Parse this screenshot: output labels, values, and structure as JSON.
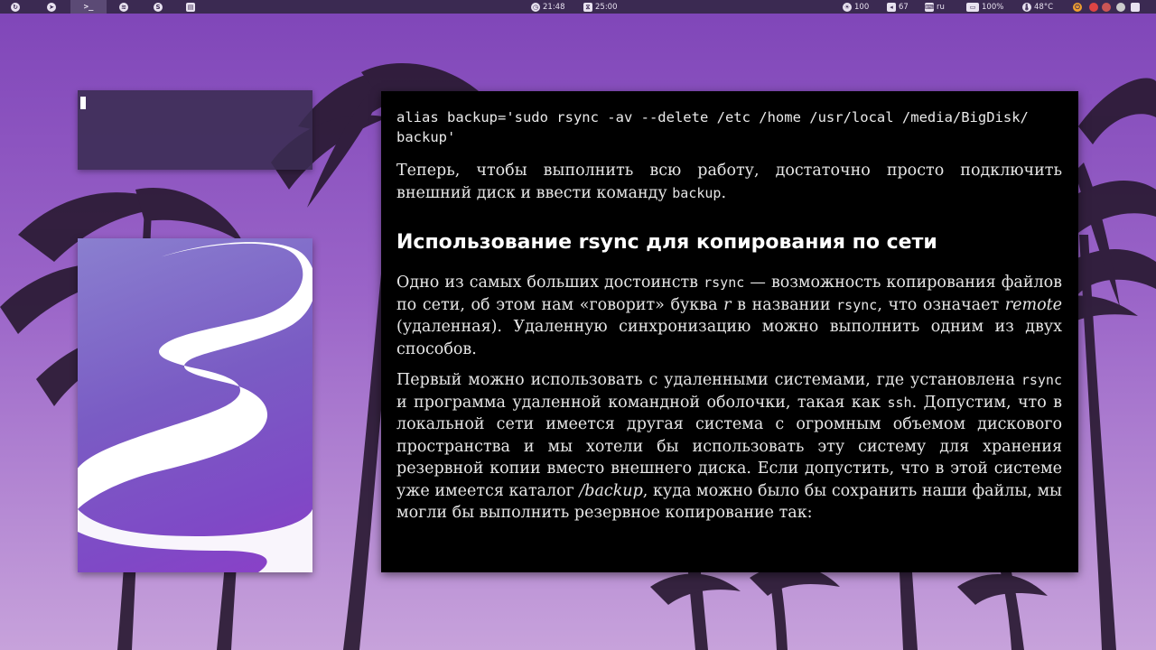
{
  "topbar": {
    "clock": "21:48",
    "timer": "25:00",
    "brightness": "100",
    "volume": "67",
    "keyboard_layout": "ru",
    "battery": "100%",
    "temperature": "48°C"
  },
  "document": {
    "code_line": "alias backup='sudo rsync -av --delete /etc /home /usr/local /media/BigDisk/\nbackup'",
    "p1": {
      "before": "Теперь, чтобы выполнить всю работу, достаточно просто подключить внешний диск и ввести команду ",
      "cmd": "backup",
      "after": "."
    },
    "heading": "Использование rsync для копирования по сети",
    "p2": {
      "t1": "Одно из самых больших достоинств ",
      "c1": "rsync",
      "t2": " — возможность копирования файлов по сети, об этом нам «говорит» буква ",
      "i1": "r",
      "t3": " в названии ",
      "c2": "rsync",
      "t4": ", что означает ",
      "i2": "remote",
      "t5": " (удаленная). Удаленную синхронизацию можно выполнить одним из двух способов."
    },
    "p3": {
      "t1": "Первый можно использовать с удаленными системами, где установлена ",
      "c1": "rsync",
      "t2": " и программа удаленной командной оболочки, такая как ",
      "c2": "ssh",
      "t3": ". Допустим, что в локальной сети имеется другая система с огромным объемом дискового пространства и мы хотели бы использовать эту систему для хранения резервной копии вместо внешнего диска. Если допустить, что в этой системе уже имеется каталог ",
      "i1": "/backup",
      "t4": ", куда можно было бы сохранить наши файлы, мы могли бы выполнить резервное копирование так:"
    }
  },
  "icons": {
    "topbar_left": [
      "menu-icon",
      "telegram-icon",
      "terminal-icon",
      "spotify-icon",
      "skype-icon",
      "document-icon"
    ],
    "topbar_right": [
      "clock-icon",
      "timer-icon",
      "brightness-icon",
      "volume-icon",
      "keyboard-icon",
      "battery-icon",
      "thermometer-icon",
      "power-icon"
    ]
  },
  "colors": {
    "topbar": "#3b2a52",
    "document_bg": "#000000",
    "logo_gradient_start": "#8a7fcf",
    "logo_gradient_end": "#8c3fc8"
  }
}
